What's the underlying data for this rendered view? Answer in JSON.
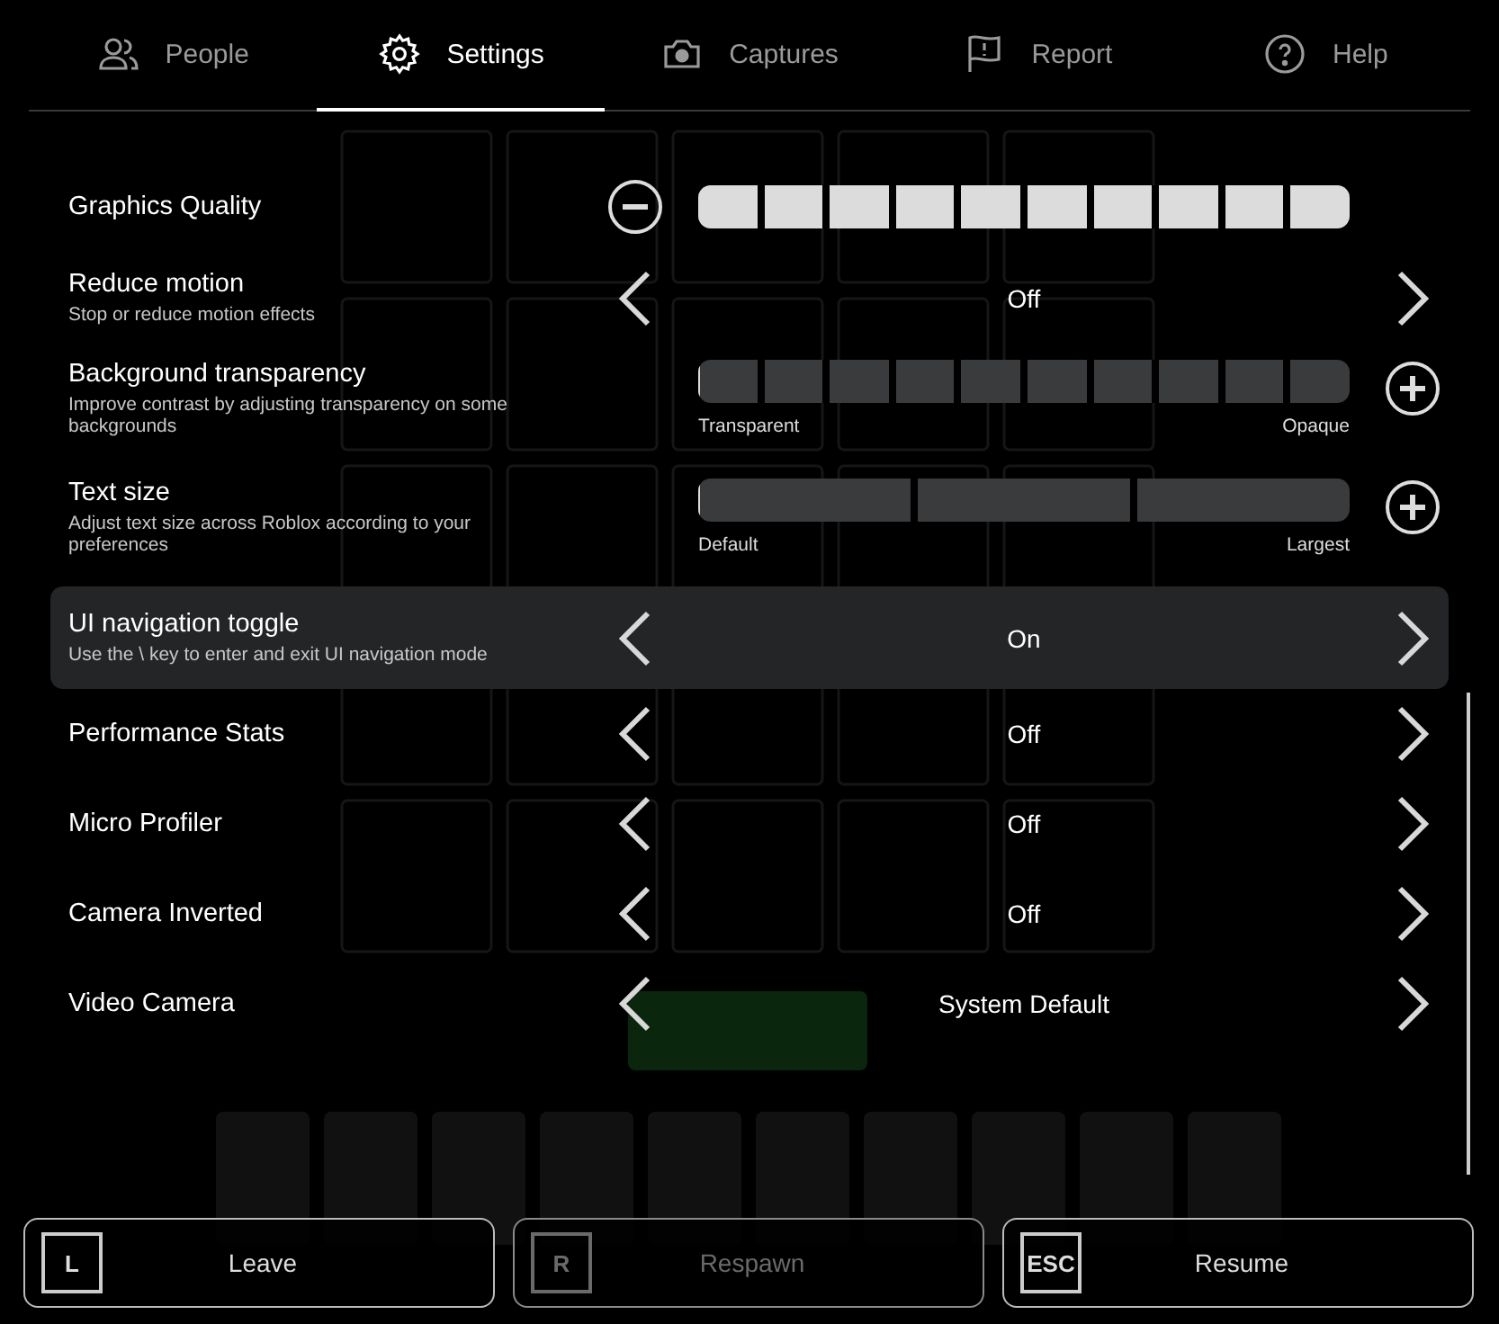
{
  "tabs": [
    {
      "label": "People",
      "selected": false
    },
    {
      "label": "Settings",
      "selected": true
    },
    {
      "label": "Captures",
      "selected": false
    },
    {
      "label": "Report",
      "selected": false
    },
    {
      "label": "Help",
      "selected": false
    }
  ],
  "settings": [
    {
      "kind": "stepper",
      "label": "Graphics Quality",
      "level": 1,
      "selected": false
    },
    {
      "kind": "cycler",
      "label": "Reduce motion",
      "description": "Stop or reduce motion effects",
      "value": "Off",
      "selected": false
    },
    {
      "kind": "stepper",
      "label": "Background transparency",
      "description": "Improve contrast by adjusting transparency on some backgrounds",
      "level": 0,
      "min_label": "Transparent",
      "max_label": "Opaque",
      "selected": false
    },
    {
      "kind": "sizer",
      "label": "Text size",
      "description": "Adjust text size across Roblox according to your preferences",
      "level": 0,
      "min_label": "Default",
      "max_label": "Largest",
      "selected": false
    },
    {
      "kind": "cycler",
      "label": "UI navigation toggle",
      "description": "Use the \\ key to enter and exit UI navigation mode",
      "value": "On",
      "selected": true
    },
    {
      "kind": "cycler",
      "label": "Performance Stats",
      "value": "Off",
      "selected": false
    },
    {
      "kind": "cycler",
      "label": "Micro Profiler",
      "value": "Off",
      "selected": false
    },
    {
      "kind": "cycler",
      "label": "Camera Inverted",
      "value": "Off",
      "selected": false
    },
    {
      "kind": "cycler",
      "label": "Video Camera",
      "value": "System Default",
      "selected": false
    }
  ],
  "actions": [
    {
      "key": "L",
      "label": "Leave",
      "disabled": false
    },
    {
      "key": "R",
      "label": "Respawn",
      "disabled": true
    },
    {
      "key": "ESC",
      "label": "Resume",
      "disabled": false
    }
  ]
}
